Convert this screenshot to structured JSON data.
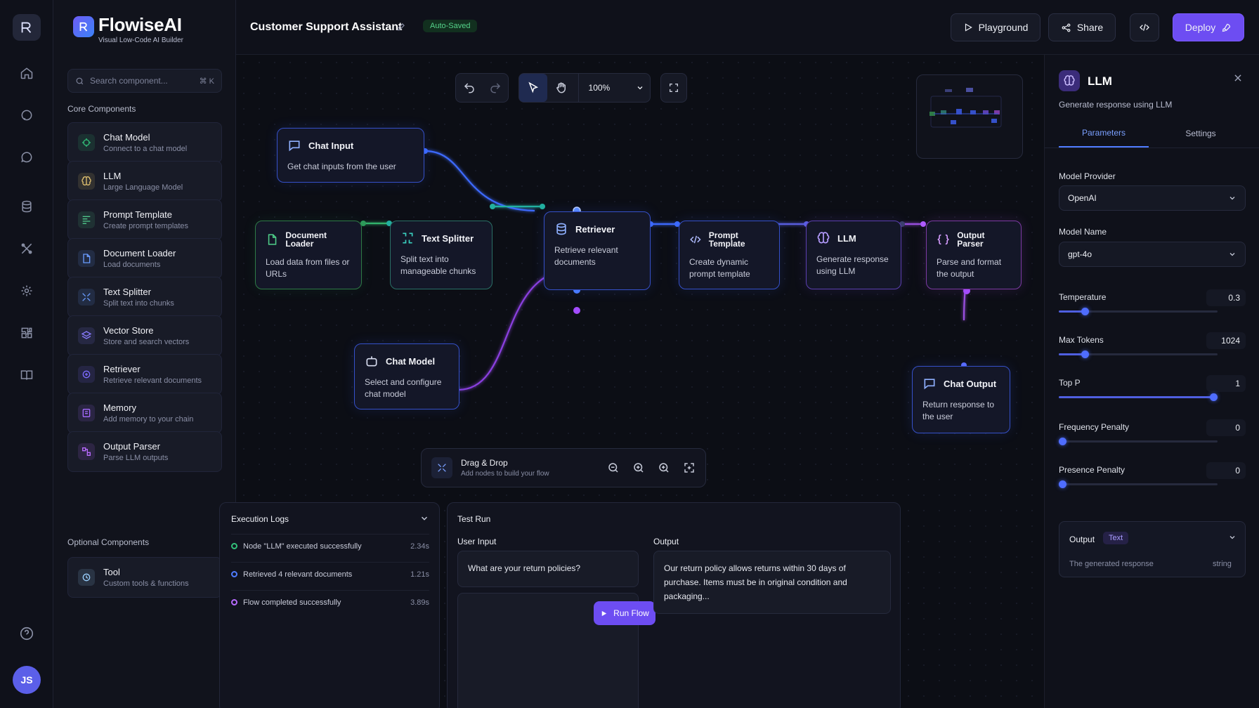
{
  "brand": {
    "name": "FlowiseAI",
    "tagline": "Visual Low-Code AI Builder"
  },
  "avatar_initials": "JS",
  "search": {
    "placeholder": "Search component...",
    "shortcut": "⌘ K"
  },
  "sidebar": {
    "core_title": "Core Components",
    "optional_title": "Optional Components",
    "core": [
      {
        "title": "Chat Model",
        "sub": "Connect to a chat model",
        "icon": "chat-model-icon",
        "color": "#33c17a"
      },
      {
        "title": "LLM",
        "sub": "Large Language Model",
        "icon": "brain-icon",
        "color": "#e0c070"
      },
      {
        "title": "Prompt Template",
        "sub": "Create prompt templates",
        "icon": "template-icon",
        "color": "#4fc58a"
      },
      {
        "title": "Document Loader",
        "sub": "Load documents",
        "icon": "document-icon",
        "color": "#6a9cff"
      },
      {
        "title": "Text Splitter",
        "sub": "Split text into chunks",
        "icon": "split-icon",
        "color": "#6a9cff"
      },
      {
        "title": "Vector Store",
        "sub": "Store and search vectors",
        "icon": "layers-icon",
        "color": "#8a7cff"
      },
      {
        "title": "Retriever",
        "sub": "Retrieve relevant documents",
        "icon": "retriever-icon",
        "color": "#7c6bff"
      },
      {
        "title": "Memory",
        "sub": "Add memory to your chain",
        "icon": "memory-icon",
        "color": "#a66bff"
      },
      {
        "title": "Output Parser",
        "sub": "Parse LLM outputs",
        "icon": "parser-icon",
        "color": "#b86bff"
      }
    ],
    "optional": [
      {
        "title": "Tool",
        "sub": "Custom tools & functions",
        "icon": "tool-icon",
        "color": "#9ad0ff"
      }
    ]
  },
  "header": {
    "flow_title": "Customer Support Assistant",
    "saved_badge": "Auto-Saved",
    "playground": "Playground",
    "share": "Share",
    "deploy": "Deploy"
  },
  "canvas": {
    "zoom": "100%",
    "nodes": {
      "chat_input": {
        "title": "Chat Input",
        "desc": "Get chat inputs from the user"
      },
      "doc_loader": {
        "title": "Document Loader",
        "desc": "Load data from files or URLs"
      },
      "text_splitter": {
        "title": "Text Splitter",
        "desc": "Split text into manageable chunks"
      },
      "retriever": {
        "title": "Retriever",
        "desc": "Retrieve relevant documents"
      },
      "prompt_template": {
        "title": "Prompt Template",
        "desc": "Create dynamic prompt template"
      },
      "llm": {
        "title": "LLM",
        "desc": "Generate response using LLM"
      },
      "output_parser": {
        "title": "Output Parser",
        "desc": "Parse and format the output"
      },
      "chat_model": {
        "title": "Chat Model",
        "desc": "Select and configure chat model"
      },
      "chat_output": {
        "title": "Chat Output",
        "desc": "Return response to the user"
      }
    },
    "drag_drop": {
      "title": "Drag & Drop",
      "sub": "Add nodes to build your flow"
    }
  },
  "logs": {
    "title": "Execution Logs",
    "rows": [
      {
        "text": "Node \"LLM\" executed successfully",
        "time": "2.34s",
        "color": "#33c17a"
      },
      {
        "text": "Retrieved 4 relevant documents",
        "time": "1.21s",
        "color": "#4f7cff"
      },
      {
        "text": "Flow completed successfully",
        "time": "3.89s",
        "color": "#b86bff"
      }
    ]
  },
  "test_run": {
    "title": "Test Run",
    "input_label": "User Input",
    "input_value": "What are your return policies?",
    "output_label": "Output",
    "output_value": "Our return policy allows returns within 30 days of purchase. Items must be in original condition and packaging...",
    "run_label": "Run Flow"
  },
  "panel": {
    "title": "LLM",
    "subtitle": "Generate response using LLM",
    "tabs": [
      "Parameters",
      "Settings"
    ],
    "provider_label": "Model Provider",
    "provider_value": "OpenAI",
    "model_label": "Model Name",
    "model_value": "gpt-4o",
    "params": [
      {
        "label": "Temperature",
        "value": "0.3",
        "fraction": 0.15
      },
      {
        "label": "Max Tokens",
        "value": "1024",
        "fraction": 0.15
      },
      {
        "label": "Top P",
        "value": "1",
        "fraction": 1.0
      },
      {
        "label": "Frequency Penalty",
        "value": "0",
        "fraction": 0.0
      },
      {
        "label": "Presence Penalty",
        "value": "0",
        "fraction": 0.0
      }
    ],
    "output": {
      "label": "Output",
      "badge": "Text",
      "desc": "The generated response",
      "type": "string"
    }
  }
}
